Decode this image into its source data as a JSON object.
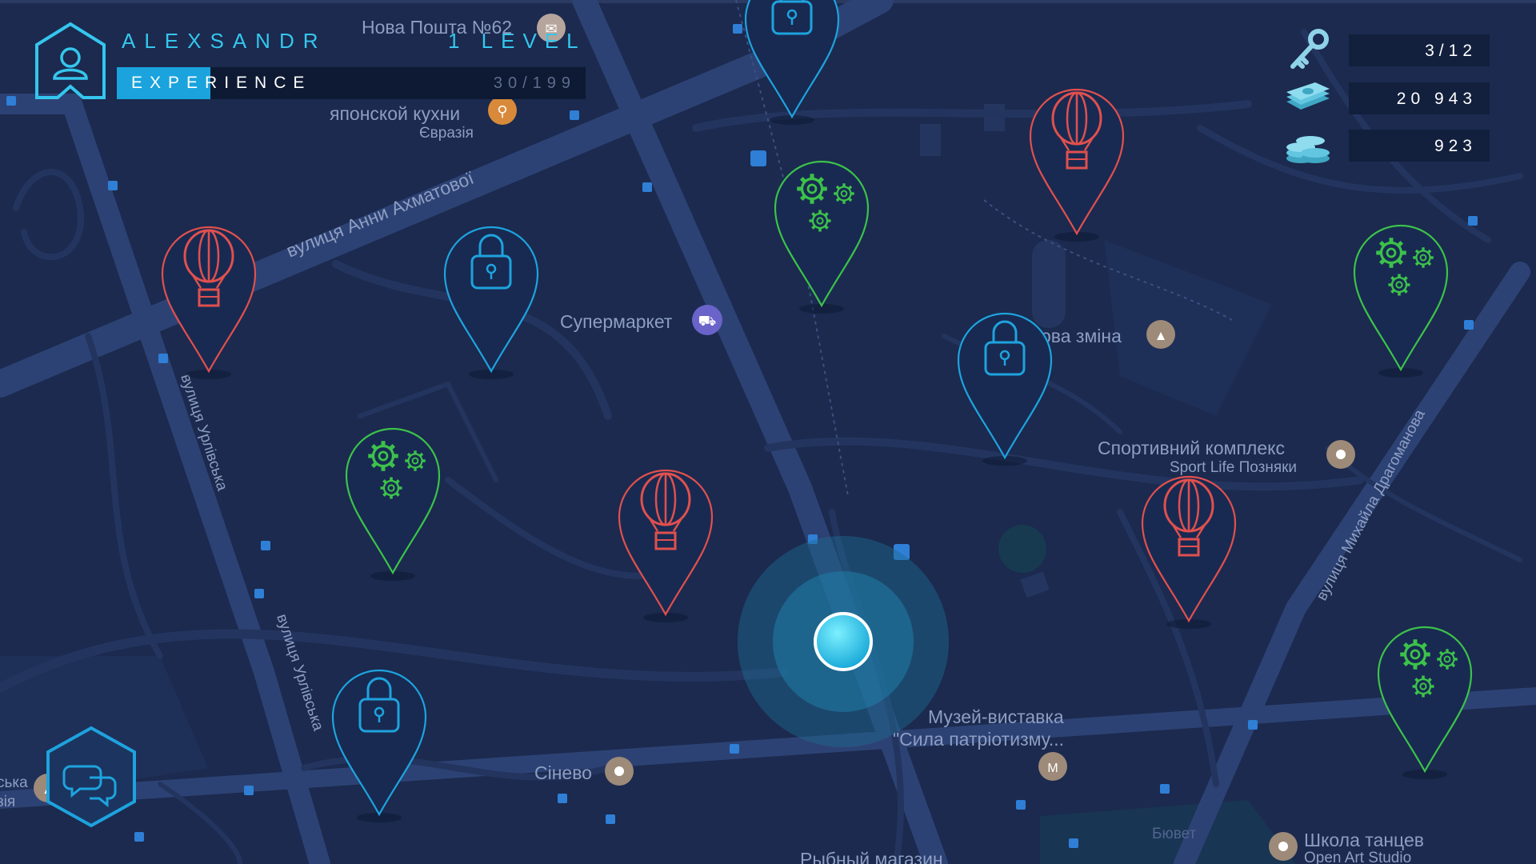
{
  "player": {
    "name": "ALEXSANDR",
    "level_label": "1 LEVEL"
  },
  "experience": {
    "label": "EXPERIENCE",
    "value": "30/199",
    "progress": 0.2
  },
  "resources": [
    {
      "name": "key-icon",
      "value": "3/12"
    },
    {
      "name": "banknotes-icon",
      "value": "20 943"
    },
    {
      "name": "coins-icon",
      "value": "923"
    }
  ],
  "map_labels": {
    "nova_poshta": "Нова Пошта №62",
    "restaurant": "японской кухни",
    "eurasia": "Євразія",
    "akhmatova_street": "вулиця Анни Ахматової",
    "supermarket": "Супермаркет",
    "science_shift": "Наукова зміна",
    "sport_complex": "Спортивний комплекс",
    "sport_life": "Sport Life Позняки",
    "urlivska_1": "вулиця Урлівська",
    "urlivska_2": "вулиця Урлівська",
    "dragomanova": "вулиця Михайла Драгоманова",
    "museum_1": "Музей-виставка",
    "museum_2": "\"Сила патріотизму...",
    "sineva": "Сінево",
    "dance_school": "Школа танцев",
    "open_art": "Open Art Studio",
    "fish_shop": "Рыбный магазин",
    "buvet": "Бювет",
    "left_edge_1": "ська",
    "left_edge_2": "зія"
  },
  "colors": {
    "map_bg": "#1b2a4e",
    "road": "#2a3c66",
    "accent_blue": "#35c6ee",
    "lock_pin": "#1ea3de",
    "balloon_pin": "#e0504e",
    "gear_pin": "#3cc24a",
    "player_dot": "#3cd6f0"
  },
  "markers": [
    {
      "type": "lock"
    },
    {
      "type": "lock"
    },
    {
      "type": "lock"
    },
    {
      "type": "lock"
    },
    {
      "type": "balloon"
    },
    {
      "type": "balloon"
    },
    {
      "type": "balloon"
    },
    {
      "type": "balloon"
    },
    {
      "type": "gears"
    },
    {
      "type": "gears"
    },
    {
      "type": "gears"
    },
    {
      "type": "gears"
    }
  ]
}
